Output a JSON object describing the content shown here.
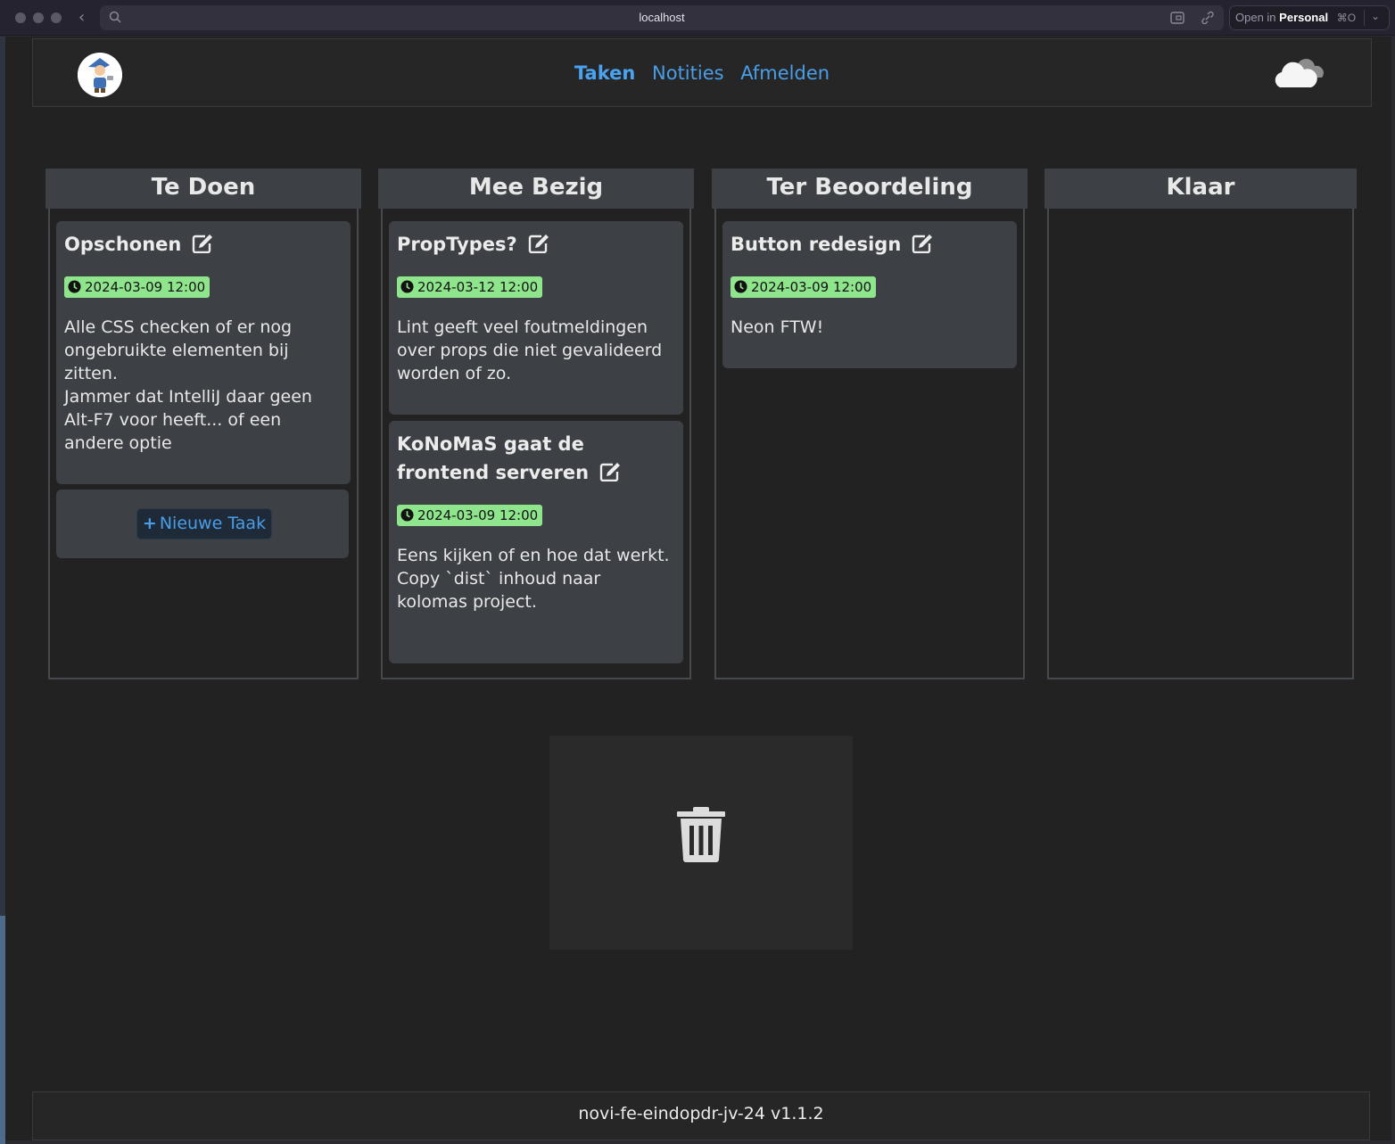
{
  "browser": {
    "url": "localhost",
    "open_in_prefix": "Open in",
    "open_in_target": "Personal",
    "open_in_shortcut": "⌘O"
  },
  "nav": {
    "items": [
      {
        "label": "Taken",
        "active": true
      },
      {
        "label": "Notities",
        "active": false
      },
      {
        "label": "Afmelden",
        "active": false
      }
    ],
    "weather_icon": "cloud-icon"
  },
  "columns": [
    {
      "title": "Te Doen",
      "cards": [
        {
          "title": "Opschonen",
          "date": "2024-03-09 12:00",
          "description": "Alle CSS checken of er nog ongebruikte elementen bij zitten.\nJammer dat IntelliJ daar geen Alt-F7 voor heeft... of een andere optie"
        }
      ],
      "new_task_label": "Nieuwe Taak"
    },
    {
      "title": "Mee Bezig",
      "cards": [
        {
          "title": "PropTypes?",
          "date": "2024-03-12 12:00",
          "description": "Lint geeft veel foutmeldingen over props die niet gevalideerd worden of zo."
        },
        {
          "title": "KoNoMaS gaat de frontend serveren",
          "date": "2024-03-09 12:00",
          "description": "Eens kijken of en hoe dat werkt.\nCopy `dist` inhoud naar kolomas project."
        }
      ]
    },
    {
      "title": "Ter Beoordeling",
      "cards": [
        {
          "title": "Button redesign",
          "date": "2024-03-09 12:00",
          "description": "Neon FTW!"
        }
      ]
    },
    {
      "title": "Klaar",
      "cards": []
    }
  ],
  "footer": {
    "text": "novi-fe-eindopdr-jv-24 v1.1.2"
  },
  "colors": {
    "accent": "#4a9ee8",
    "date_badge": "#8ee58c",
    "card_bg": "#3d4044",
    "page_bg": "#222222"
  }
}
